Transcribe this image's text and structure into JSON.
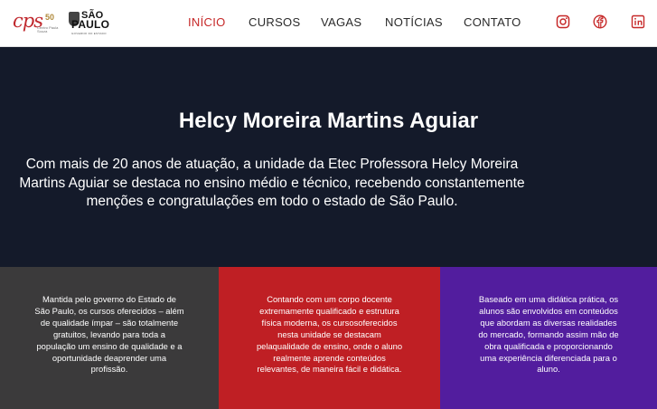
{
  "header": {
    "logo_cps": {
      "mark": "cps",
      "anniversary": "50",
      "subtitle": "Centro Paula Souza",
      "alt": "Centro Paula Souza logo"
    },
    "logo_sp": {
      "line1": "SÃO",
      "line2": "PAULO",
      "tagline": "GOVERNO DO ESTADO",
      "alt": "Governo do Estado de São Paulo logo"
    },
    "nav": [
      {
        "label": "INÍCIO",
        "active": true
      },
      {
        "label": "CURSOS",
        "active": false
      },
      {
        "label": "VAGAS",
        "active": false
      },
      {
        "label": "NOTÍCIAS",
        "active": false
      },
      {
        "label": "CONTATO",
        "active": false
      }
    ],
    "social": [
      {
        "icon": "instagram-icon"
      },
      {
        "icon": "facebook-icon"
      },
      {
        "icon": "linkedin-icon"
      }
    ],
    "accent_color": "#c62828"
  },
  "hero": {
    "title": "Helcy Moreira Martins Aguiar",
    "text": "Com mais de 20 anos de atuação, a unidade da Etec Professora Helcy Moreira Martins Aguiar se destaca no ensino médio e técnico, recebendo constantemente menções e congratulações em todo o estado de São Paulo.",
    "background": "#141a2a"
  },
  "features": [
    {
      "text": "Mantida pelo governo do Estado de São Paulo, os cursos oferecidos – além de qualidade ímpar – são totalmente gratuitos, levando para toda a população um ensino de qualidade e a oportunidade deaprender uma profissão.",
      "color": "#3b3a3b"
    },
    {
      "text": "Contando com um corpo docente extremamente qualificado e estrutura física moderna, os cursosoferecidos nesta unidade se destacam pelaqualidade de ensino, onde o aluno realmente aprende conteúdos relevantes, de maneira fácil e didática.",
      "color": "#bf1f24"
    },
    {
      "text": "Baseado em uma didática prática, os alunos são envolvidos em conteúdos que abordam as diversas realidades do mercado, formando assim mão de obra qualificada e proporcionando uma experiência diferenciada para o aluno.",
      "color": "#521d9e"
    }
  ]
}
